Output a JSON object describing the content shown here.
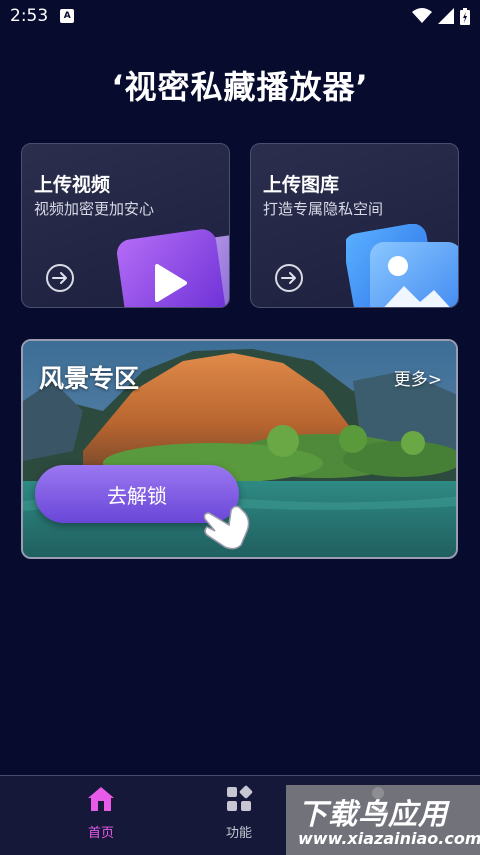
{
  "status_bar": {
    "time": "2:53",
    "sim_label": "A"
  },
  "app": {
    "title": "‘视密私藏播放器’"
  },
  "cards": {
    "upload_video": {
      "title": "上传视频",
      "subtitle": "视频加密更加安心"
    },
    "upload_gallery": {
      "title": "上传图库",
      "subtitle": "打造专属隐私空间"
    }
  },
  "banner": {
    "title": "风景专区",
    "more": "更多>",
    "unlock_label": "去解锁"
  },
  "bottom_nav": {
    "items": [
      {
        "label": "首页",
        "icon": "home-icon",
        "active": true
      },
      {
        "label": "功能",
        "icon": "grid-icon",
        "active": false
      },
      {
        "label": "",
        "icon": "user-icon",
        "active": false
      }
    ]
  },
  "watermark": {
    "main": "下载鸟应用",
    "sub": "www.xiazainiao.com"
  },
  "colors": {
    "background": "#070b2e",
    "accent_active": "#e85be8",
    "button_purple": "#7a56e0"
  }
}
